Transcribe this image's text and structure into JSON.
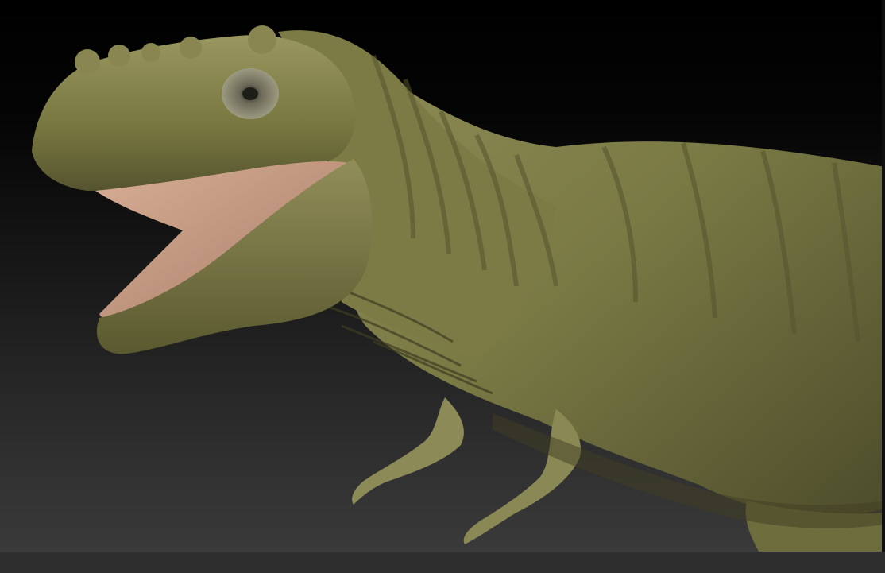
{
  "app": {
    "window_title": ""
  },
  "viewport": {
    "subject_icon": "trex-sculpt-icon",
    "colors": {
      "background_top": "#000000",
      "background_bottom": "#3a3a3a",
      "skin_base": "#7a7a45",
      "skin_highlight": "#a9a56b",
      "skin_shadow": "#3f3e22",
      "mouth_inner": "#c79b84",
      "frame_line": "#6a6a6a"
    }
  }
}
